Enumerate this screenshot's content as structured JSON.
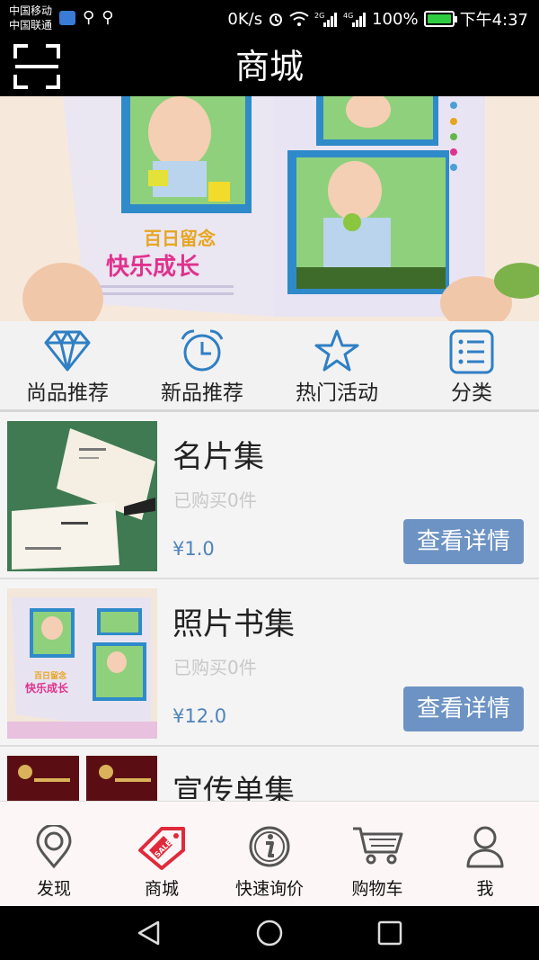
{
  "status_bar": {
    "carrier_1": "中国移动",
    "carrier_2": "中国联通",
    "net_speed": "0K/s",
    "signal_1": "2G",
    "signal_2": "4G",
    "battery_text": "100%",
    "battery_level": 1.0,
    "time": "下午4:37"
  },
  "header": {
    "title": "商城",
    "scan_icon": "scan-icon"
  },
  "banner": {
    "book_caption_top": "百日留念",
    "book_caption_main": "快乐成长",
    "slide_count": 6,
    "active_slide": 4
  },
  "categories": [
    {
      "label": "尚品推荐",
      "icon": "diamond-icon"
    },
    {
      "label": "新品推荐",
      "icon": "alarm-clock-icon"
    },
    {
      "label": "热门活动",
      "icon": "star-icon"
    },
    {
      "label": "分类",
      "icon": "list-icon"
    }
  ],
  "products": [
    {
      "name": "名片集",
      "sold": "已购买0件",
      "price": "¥1.0",
      "button": "查看详情"
    },
    {
      "name": "照片书集",
      "sold": "已购买0件",
      "price": "¥12.0",
      "button": "查看详情"
    },
    {
      "name": "宣传单集",
      "sold": "",
      "price": "",
      "button": ""
    }
  ],
  "tabs": [
    {
      "label": "发现",
      "icon": "location-pin-icon"
    },
    {
      "label": "商城",
      "icon": "sale-tag-icon"
    },
    {
      "label": "快速询价",
      "icon": "info-icon"
    },
    {
      "label": "购物车",
      "icon": "cart-icon"
    },
    {
      "label": "我",
      "icon": "person-icon"
    }
  ],
  "colors": {
    "accent_blue": "#2f7fc4",
    "button_blue": "#6d93c4",
    "price_blue": "#4f84bd",
    "sale_red": "#e02a3c",
    "dot_active": "#1fb53b"
  }
}
